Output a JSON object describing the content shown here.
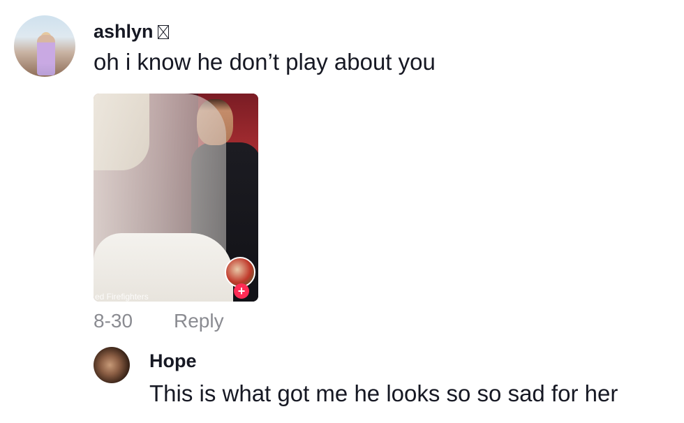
{
  "comments": [
    {
      "username": "ashlyn",
      "text": "oh i know he don’t play about you",
      "media": {
        "caption": "ed Firefighters",
        "follow_symbol": "+"
      },
      "date": "8-30",
      "reply_label": "Reply"
    },
    {
      "username": "Hope",
      "text": "This is what got me he looks so so sad for her"
    }
  ],
  "colors": {
    "text_primary": "#161823",
    "text_secondary": "#8a8b91",
    "follow_accent": "#fe2c55"
  },
  "icons": {
    "username_glyph": "missing-glyph-box-icon"
  }
}
